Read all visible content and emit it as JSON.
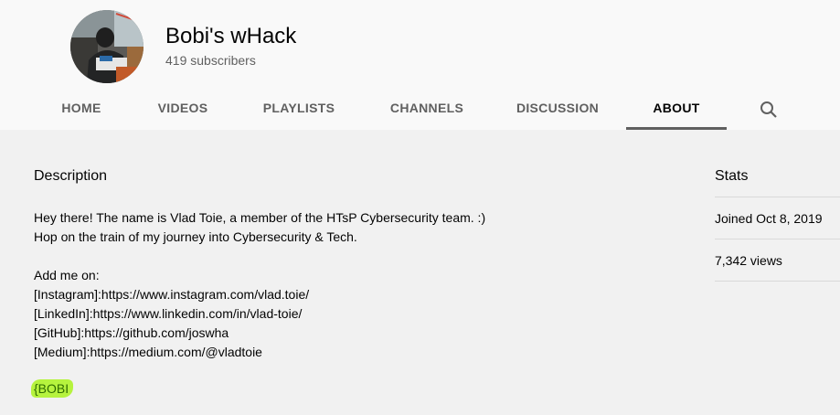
{
  "channel": {
    "name": "Bobi's wHack",
    "subscribers": "419 subscribers"
  },
  "tabs": [
    {
      "label": "HOME"
    },
    {
      "label": "VIDEOS"
    },
    {
      "label": "PLAYLISTS"
    },
    {
      "label": "CHANNELS"
    },
    {
      "label": "DISCUSSION"
    },
    {
      "label": "ABOUT",
      "active": true
    }
  ],
  "search_icon": "search-icon",
  "description": {
    "title": "Description",
    "lines": [
      "Hey there! The name is Vlad Toie, a member of the HTsP Cybersecurity team. :)",
      "Hop on the train of my journey into Cybersecurity & Tech.",
      "Add me on:",
      "[Instagram]:https://www.instagram.com/vlad.toie/",
      "[LinkedIn]:https://www.linkedin.com/in/vlad-toie/",
      "[GitHub]:https://github.com/joswha",
      "[Medium]:https://medium.com/@vladtoie"
    ],
    "highlight": "{BOBI"
  },
  "stats": {
    "title": "Stats",
    "joined": "Joined Oct 8, 2019",
    "views": "7,342 views"
  },
  "colors": {
    "page_bg": "#f1f1f1",
    "header_bg": "#f9f9f9",
    "highlight": "#b6f33e",
    "highlight_text": "#2f6c00",
    "tab_text": "#606060",
    "active_tab_text": "#030303"
  }
}
